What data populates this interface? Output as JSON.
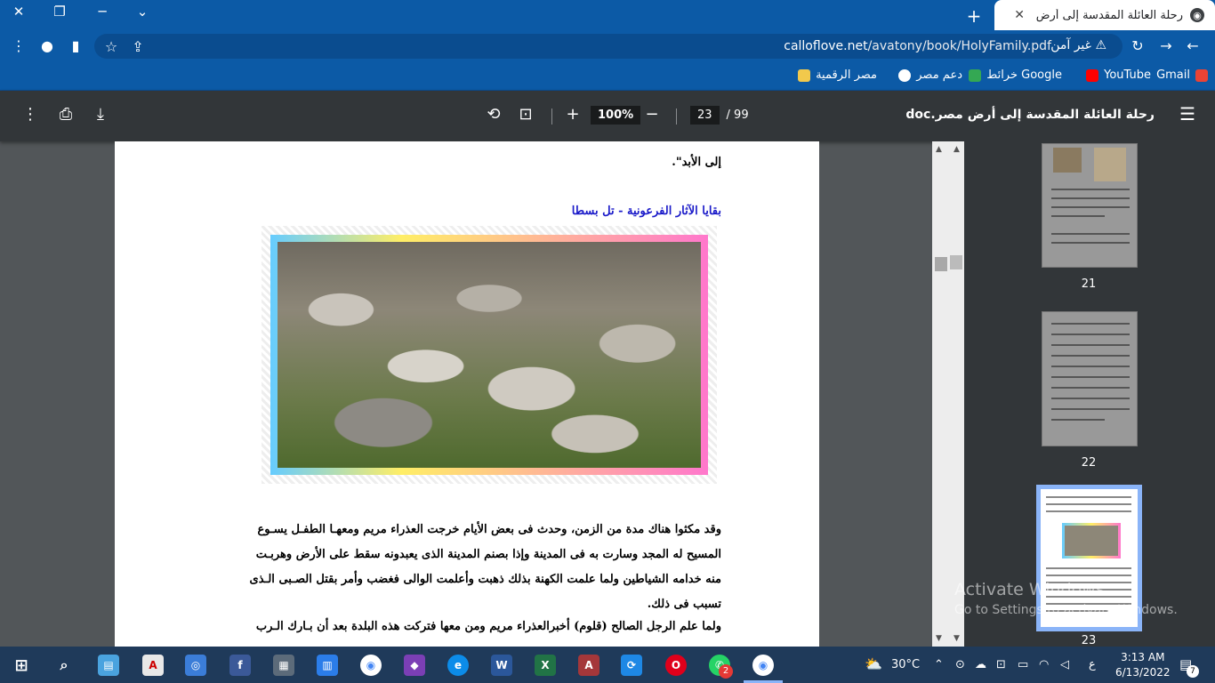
{
  "browser": {
    "tab_title": "رحلة العائلة المقدسة إلى أرض مصر",
    "url_domain": "calloflove.net",
    "url_path": "/avatony/book/HolyFamily.pdf",
    "security_label": "غير آمن",
    "bookmarks": [
      {
        "label": "Gmail",
        "icon": "gmail-icon",
        "color": "#ea4335"
      },
      {
        "label": "YouTube",
        "icon": "youtube-icon",
        "color": "#ff0000"
      },
      {
        "label": "خرائط Google",
        "icon": "maps-icon",
        "color": "#34a853"
      },
      {
        "label": "دعم مصر",
        "icon": "globe-icon",
        "color": "#ffffff"
      },
      {
        "label": "مصر الرقمية",
        "icon": "digital-egypt-icon",
        "color": "#f2c94c"
      }
    ]
  },
  "pdf_toolbar": {
    "doc_title": "رحلة العائلة المقدسة إلى أرض مصر.doc",
    "page_current": "23",
    "page_total": "/ 99",
    "zoom": "100%"
  },
  "page": {
    "line_top": "إلى الأبد\".",
    "heading": "بقايا الآثار الفرعونية - تل بسطا",
    "paragraph1": [
      "وقد مكثوا هناك مدة من الزمن، وحدث فى بعض الأيام خرجت العذراء مريم ومعهـا الطفـل يسـوع",
      "المسيح له المجد وسارت به فى المدينة وإذا بصنم المدينة الذى يعبدونه سقط على الأرض وهربـت",
      "منه خدامه الشياطين ولما علمت الكهنة بذلك ذهبت وأعلمت الوالى فغضب وأمر بقتل الصـبى الـذى",
      "تسبب فى ذلك."
    ],
    "paragraph2": "ولما علم الرجل الصالح (قلوم) أخبرالعذراء مريم ومن معها فتركت هذه البلدة بعد أن بـارك الـرب"
  },
  "thumbnails": [
    {
      "number": "21"
    },
    {
      "number": "22"
    },
    {
      "number": "23"
    }
  ],
  "watermark": {
    "line1": "Activate Windows",
    "line2": "Go to Settings to activate Windows."
  },
  "taskbar": {
    "temperature": "30°C",
    "time": "3:13 AM",
    "date": "6/13/2022",
    "lang": "ع",
    "whatsapp_badge": "2",
    "notif_count": "7"
  }
}
